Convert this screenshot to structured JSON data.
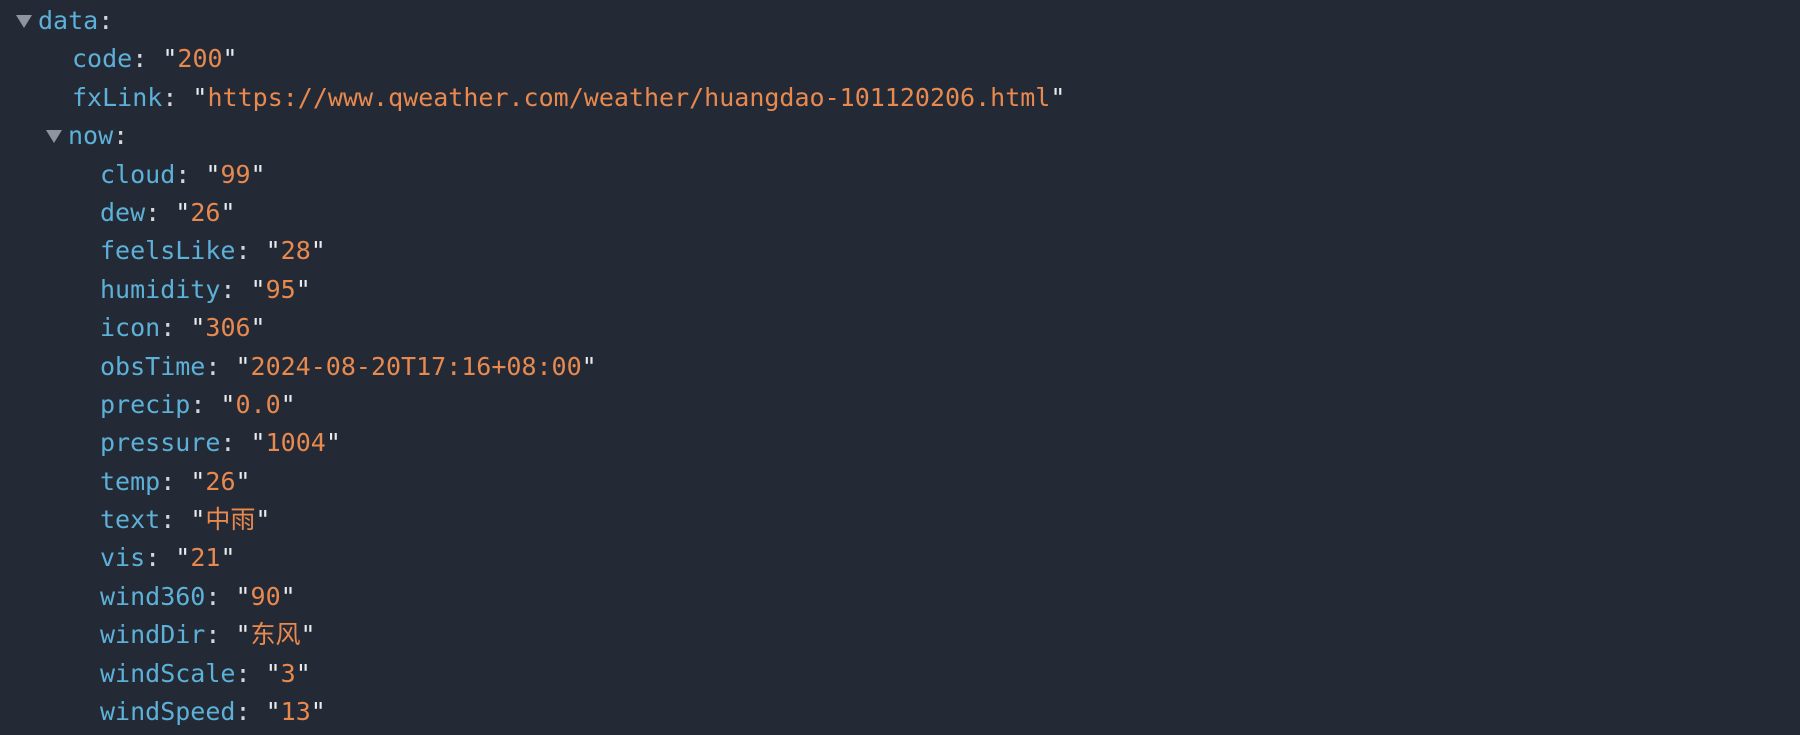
{
  "root": {
    "key": "data"
  },
  "fields": [
    {
      "key": "code",
      "value": "200"
    },
    {
      "key": "fxLink",
      "value": "https://www.qweather.com/weather/huangdao-101120206.html"
    }
  ],
  "now": {
    "key": "now",
    "fields": [
      {
        "key": "cloud",
        "value": "99"
      },
      {
        "key": "dew",
        "value": "26"
      },
      {
        "key": "feelsLike",
        "value": "28"
      },
      {
        "key": "humidity",
        "value": "95"
      },
      {
        "key": "icon",
        "value": "306"
      },
      {
        "key": "obsTime",
        "value": "2024-08-20T17:16+08:00"
      },
      {
        "key": "precip",
        "value": "0.0"
      },
      {
        "key": "pressure",
        "value": "1004"
      },
      {
        "key": "temp",
        "value": "26"
      },
      {
        "key": "text",
        "value": "中雨"
      },
      {
        "key": "vis",
        "value": "21"
      },
      {
        "key": "wind360",
        "value": "90"
      },
      {
        "key": "windDir",
        "value": "东风"
      },
      {
        "key": "windScale",
        "value": "3"
      },
      {
        "key": "windSpeed",
        "value": "13"
      }
    ]
  },
  "colors": {
    "background": "#242a35",
    "key": "#5db0d7",
    "string": "#e8894f",
    "punctuation": "#d4d8de",
    "toggle": "#8e959f"
  },
  "icons": {
    "expanded_toggle": "triangle-down-icon"
  }
}
